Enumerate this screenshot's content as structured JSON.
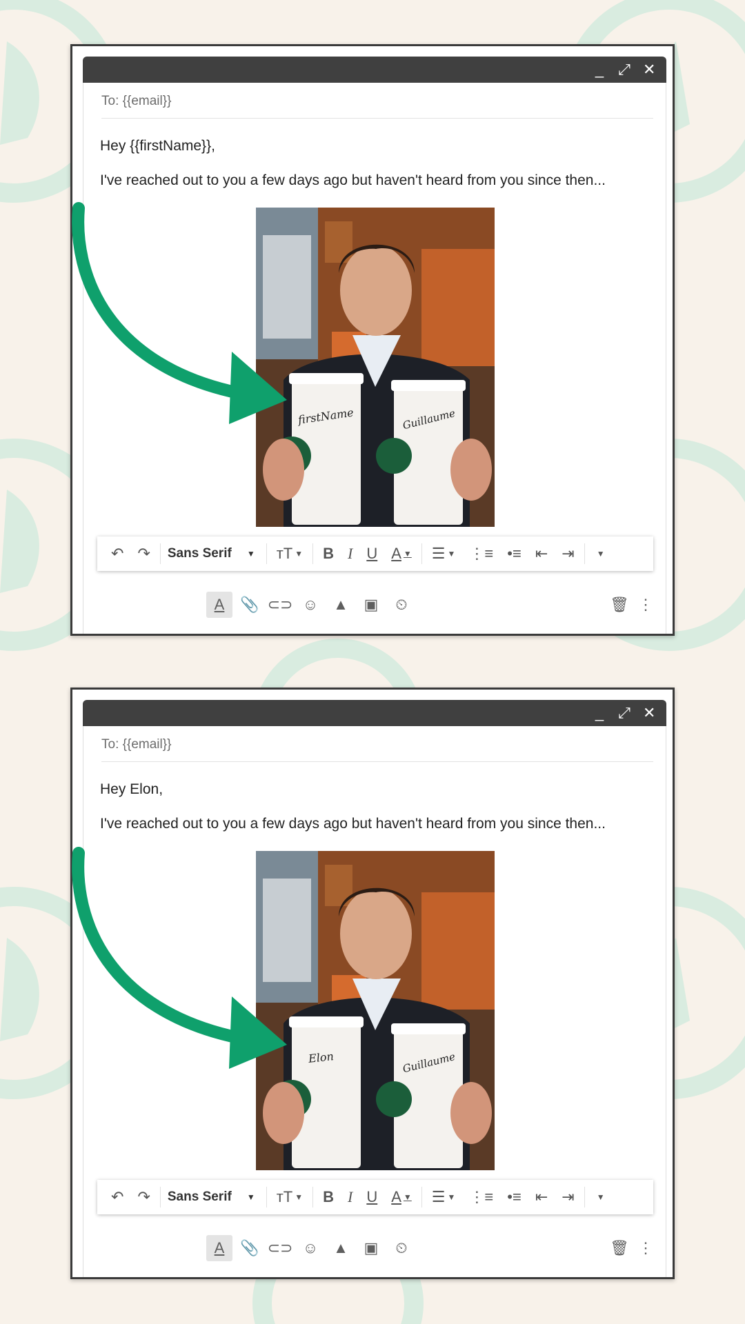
{
  "colors": {
    "background": "#f8f2ea",
    "deco": "#d9ece0",
    "arrow": "#0fa06c",
    "titlebar": "#404040"
  },
  "window_controls": {
    "minimize": "_",
    "maximize": "⤢",
    "close": "✕"
  },
  "panels": [
    {
      "to_line": "To: {{email}}",
      "greeting": "Hey {{firstName}},",
      "body": "I've reached out to you a few days ago but haven't heard from you since then...",
      "cup_left_text": "firstName",
      "cup_right_text": "Guillaume"
    },
    {
      "to_line": "To: {{email}}",
      "greeting": "Hey Elon,",
      "body": "I've reached out to you a few days ago but haven't heard from you since then...",
      "cup_left_text": "Elon",
      "cup_right_text": "Guillaume"
    }
  ],
  "toolbar": {
    "font_name": "Sans Serif",
    "icons": [
      "undo-icon",
      "redo-icon",
      "font-dropdown",
      "text-size-icon",
      "bold-icon",
      "italic-icon",
      "underline-icon",
      "text-color-icon",
      "align-icon",
      "numbered-list-icon",
      "bulleted-list-icon",
      "indent-less-icon",
      "indent-more-icon",
      "more-formatting-icon"
    ]
  },
  "bottom_actions": [
    "formatting-options-icon",
    "attach-icon",
    "link-icon",
    "emoji-icon",
    "drive-icon",
    "photo-icon",
    "confidential-icon",
    "discard-icon",
    "more-options-icon"
  ]
}
